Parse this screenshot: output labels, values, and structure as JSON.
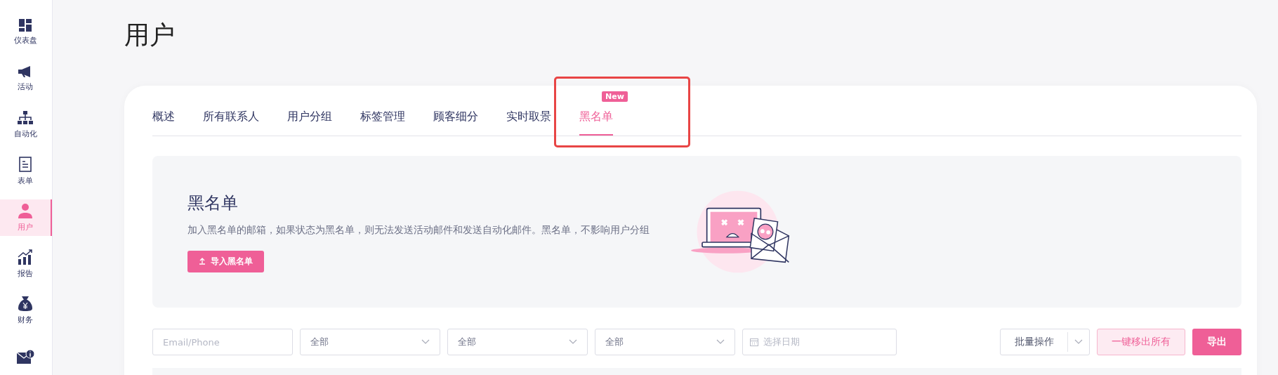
{
  "sidebar": {
    "items": [
      {
        "label": "仪表盘",
        "selected": false
      },
      {
        "label": "活动",
        "selected": false
      },
      {
        "label": "自动化",
        "selected": false
      },
      {
        "label": "表单",
        "selected": false
      },
      {
        "label": "用户",
        "selected": true
      },
      {
        "label": "报告",
        "selected": false
      },
      {
        "label": "财务",
        "selected": false
      },
      {
        "selected": false
      }
    ]
  },
  "page_title": "用户",
  "tabs": [
    {
      "label": "概述",
      "selected": false
    },
    {
      "label": "所有联系人",
      "selected": false
    },
    {
      "label": "用户分组",
      "selected": false
    },
    {
      "label": "标签管理",
      "selected": false
    },
    {
      "label": "顾客细分",
      "selected": false
    },
    {
      "label": "实时取景",
      "selected": false
    },
    {
      "label": "黑名单",
      "selected": true,
      "badge": "New"
    }
  ],
  "banner": {
    "title": "黑名单",
    "description": "加入黑名单的邮箱，如果状态为黑名单，则无法发送活动邮件和发送自动化邮件。黑名单，不影响用户分组",
    "button": "导入黑名单"
  },
  "filters": {
    "search": {
      "placeholder": "Email/Phone"
    },
    "selects": [
      {
        "value": "全部"
      },
      {
        "value": "全部"
      },
      {
        "value": "全部"
      }
    ],
    "date": {
      "placeholder": "选择日期"
    },
    "bulk_action": "批量操作",
    "remove_all": "一键移出所有",
    "export": "导出"
  }
}
